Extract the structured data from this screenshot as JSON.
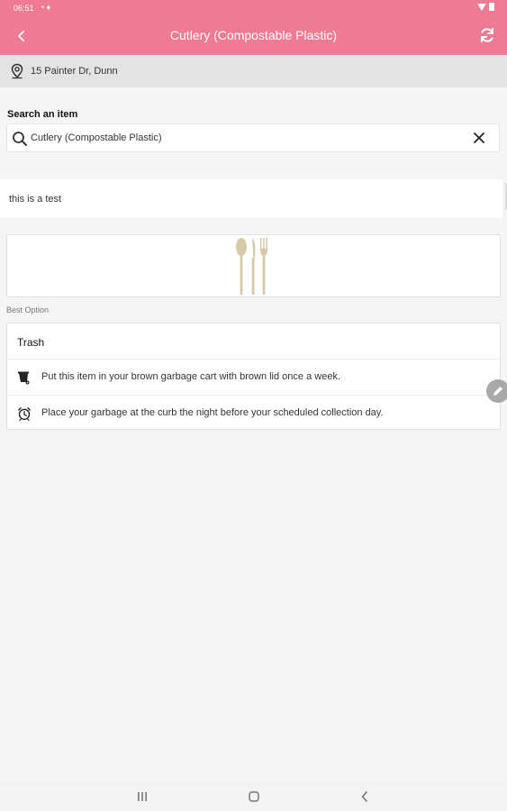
{
  "status_bar": {
    "time": "06:51",
    "indicators": "• ♦"
  },
  "app_bar": {
    "title": "Cutlery (Compostable Plastic)",
    "back_icon": "back-chevron-icon",
    "refresh_icon": "refresh-icon",
    "color": "#ee7b93"
  },
  "location": {
    "address": "15 Painter Dr, Dunn",
    "icon": "location-pin-icon"
  },
  "search": {
    "label": "Search an item",
    "value": "Cutlery (Compostable Plastic)",
    "placeholder": "Search an item",
    "icon": "search-icon",
    "clear_icon": "close-icon"
  },
  "note": {
    "text": "this is a test"
  },
  "item_image": {
    "alt": "cutlery-illustration"
  },
  "best_option": {
    "label": "Best Option",
    "title": "Trash",
    "rows": [
      {
        "icon": "garbage-cart-icon",
        "text": "Put this item in your brown garbage cart with brown lid once a week."
      },
      {
        "icon": "alarm-clock-icon",
        "text": "Place your garbage at the curb the night before your scheduled collection day."
      }
    ]
  },
  "fab": {
    "icon": "edit-pencil-icon"
  },
  "nav": {
    "recents_icon": "recents-icon",
    "home_icon": "home-icon",
    "back_icon": "nav-back-icon"
  }
}
